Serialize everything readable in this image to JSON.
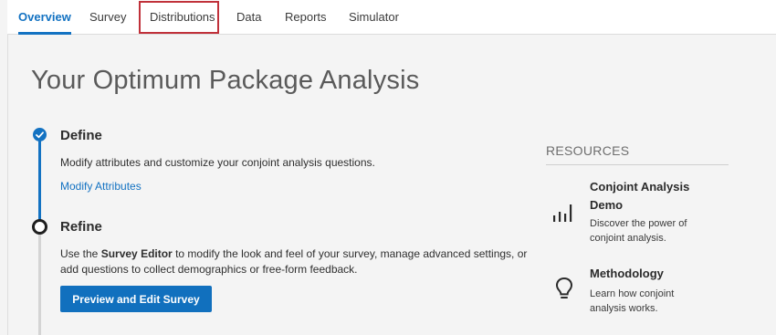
{
  "tabs": [
    {
      "label": "Overview",
      "active": true
    },
    {
      "label": "Survey",
      "active": false
    },
    {
      "label": "Distributions",
      "active": false
    },
    {
      "label": "Data",
      "active": false
    },
    {
      "label": "Reports",
      "active": false
    },
    {
      "label": "Simulator",
      "active": false
    }
  ],
  "page": {
    "title": "Your Optimum Package Analysis"
  },
  "steps": {
    "define": {
      "status": "complete",
      "title": "Define",
      "text": "Modify attributes and customize your conjoint analysis questions.",
      "link": "Modify Attributes"
    },
    "refine": {
      "status": "current",
      "title": "Refine",
      "text_before": "Use the ",
      "text_bold": "Survey Editor",
      "text_after": " to modify the look and feel of your survey, manage advanced settings, or add questions to collect demographics or free-form feedback.",
      "button": "Preview and Edit Survey"
    }
  },
  "resources": {
    "heading": "RESOURCES",
    "items": [
      {
        "icon": "bar-chart-icon",
        "title": "Conjoint Analysis Demo",
        "description": "Discover the power of conjoint analysis."
      },
      {
        "icon": "lightbulb-icon",
        "title": "Methodology",
        "description": "Learn how conjoint analysis works."
      }
    ]
  },
  "colors": {
    "accent": "#1372c2",
    "highlight": "#c0313a",
    "background": "#f4f4f4"
  }
}
